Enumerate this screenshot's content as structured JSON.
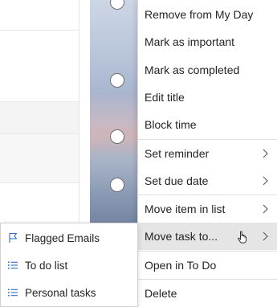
{
  "context_menu": {
    "items": [
      {
        "label": "Remove from My Day",
        "submenu": false
      },
      {
        "label": "Mark as important",
        "submenu": false
      },
      {
        "label": "Mark as completed",
        "submenu": false
      },
      {
        "label": "Edit title",
        "submenu": false
      },
      {
        "label": "Block time",
        "submenu": false
      },
      {
        "label": "Set reminder",
        "submenu": true
      },
      {
        "label": "Set due date",
        "submenu": true
      },
      {
        "label": "Move item in list",
        "submenu": true
      },
      {
        "label": "Move task to...",
        "submenu": true,
        "active": true
      },
      {
        "label": "Open in To Do",
        "submenu": false
      },
      {
        "label": "Delete",
        "submenu": false
      }
    ]
  },
  "submenu": {
    "items": [
      {
        "label": "Flagged Emails",
        "icon": "flag-icon"
      },
      {
        "label": "To do list",
        "icon": "list-icon"
      },
      {
        "label": "Personal tasks",
        "icon": "list-icon"
      }
    ]
  },
  "colors": {
    "accent": "#2f6ec4",
    "menu_text": "#252423",
    "active_bg": "#e5e5e5"
  }
}
